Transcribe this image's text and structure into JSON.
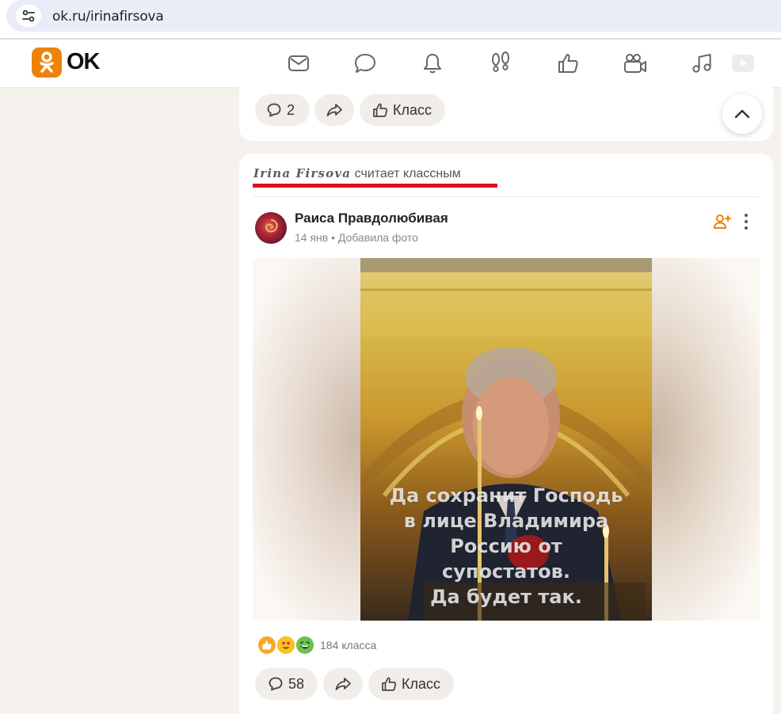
{
  "browser": {
    "url": "ok.ru/irinafirsova"
  },
  "header": {
    "logo_text": "OK",
    "nav_icons": [
      "mail-icon",
      "chat-icon",
      "bell-icon",
      "footprints-icon",
      "like-icon",
      "video-camera-icon",
      "music-icon",
      "video-play-icon"
    ]
  },
  "top_card": {
    "comments_count": "2",
    "like_label": "Класс"
  },
  "feed_item": {
    "liker_name": "Irina Firsova",
    "action_text": "считает классным",
    "author": "Раиса Правдолюбивая",
    "date": "14 янв",
    "separator": "•",
    "action": "Добавила фото",
    "photo_caption_lines": [
      "Да сохранит Господь",
      "в лице Владимира",
      "Россию от",
      "супостатов.",
      "Да будет так."
    ],
    "reactions_count": "184 класса",
    "comments_count": "58",
    "like_label": "Класс"
  },
  "colors": {
    "brand": "#ee8208",
    "highlight_underline": "#e01020",
    "pill_bg": "#f1ede8"
  }
}
